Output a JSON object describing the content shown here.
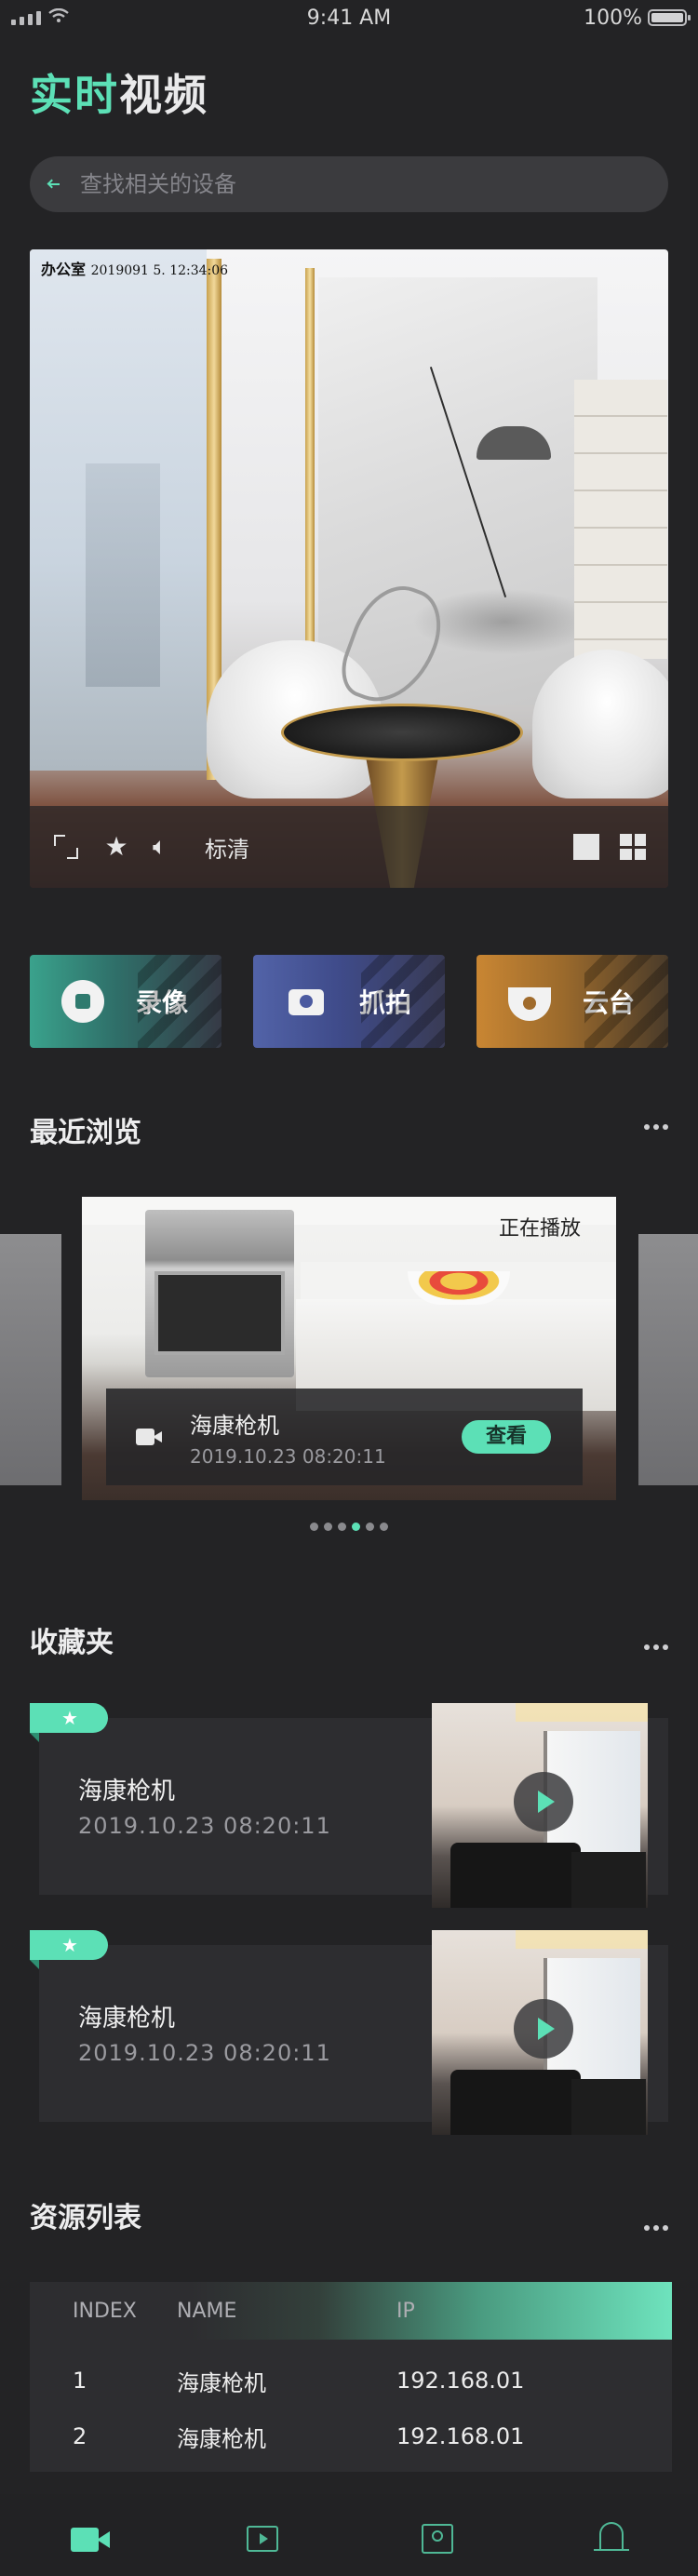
{
  "status_bar": {
    "time": "9:41 AM",
    "battery": "100%"
  },
  "header": {
    "title_accent": "实时",
    "title_rest": "视频"
  },
  "search": {
    "placeholder": "查找相关的设备"
  },
  "video": {
    "location": "办公室",
    "timestamp": "2019091 5. 12:34:06",
    "quality": "标清"
  },
  "actions": [
    {
      "label": "录像",
      "icon": "record-icon"
    },
    {
      "label": "抓拍",
      "icon": "camera-icon"
    },
    {
      "label": "云台",
      "icon": "ptz-dome-icon"
    }
  ],
  "recent": {
    "title": "最近浏览",
    "status": "正在播放",
    "device_name": "海康枪机",
    "date": "2019.10.23 08:20:11",
    "view_label": "查看",
    "page_count": 6,
    "active_page": 4
  },
  "favorites": {
    "title": "收藏夹",
    "items": [
      {
        "name": "海康枪机",
        "date": "2019.10.23   08:20:11"
      },
      {
        "name": "海康枪机",
        "date": "2019.10.23   08:20:11"
      }
    ]
  },
  "resources": {
    "title": "资源列表",
    "columns": [
      "INDEX",
      "NAME",
      "IP"
    ],
    "rows": [
      [
        "1",
        "海康枪机",
        "192.168.01"
      ],
      [
        "2",
        "海康枪机",
        "192.168.01"
      ]
    ]
  },
  "tabbar": {
    "items": [
      {
        "icon": "video-camera-icon",
        "active": true
      },
      {
        "icon": "play-icon",
        "active": false
      },
      {
        "icon": "profile-card-icon",
        "active": false
      },
      {
        "icon": "bell-icon",
        "active": false
      }
    ]
  },
  "colors": {
    "accent": "#5ce0b6",
    "background": "#232325",
    "panel": "#2d2d30"
  }
}
